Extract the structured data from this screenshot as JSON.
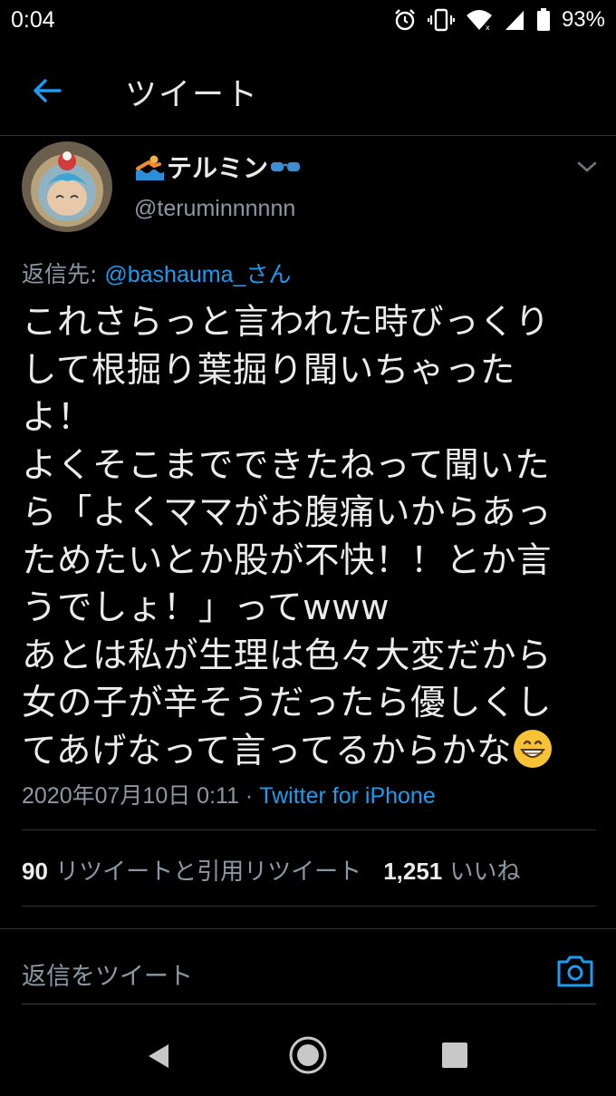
{
  "status": {
    "time": "0:04",
    "battery": "93%"
  },
  "header": {
    "title": "ツイート"
  },
  "tweet": {
    "display_name": "テルミン",
    "username": "@teruminnnnnn",
    "reply_prefix": "返信先: ",
    "reply_to": "@bashauma_さん",
    "body": "これさらっと言われた時びっくり\nして根掘り葉掘り聞いちゃった\nよ！\nよくそこまでできたねって聞いた\nら「よくママがお腹痛いからあっ\nためたいとか股が不快！！とか言\nうでしょ！」ってwww\nあとは私が生理は色々大変だから\n女の子が辛そうだったら優しくし\nてあげなって言ってるからかな",
    "timestamp": "2020年07月10日 0:11",
    "separator": " · ",
    "source": "Twitter for iPhone"
  },
  "stats": {
    "retweets_count": "90",
    "retweets_label": " リツイートと引用リツイート",
    "likes_count": "1,251",
    "likes_label": " いいね"
  },
  "reply": {
    "placeholder": "返信をツイート"
  },
  "colors": {
    "accent": "#1d9bf0",
    "muted": "#8b98a5",
    "background": "#000000"
  }
}
